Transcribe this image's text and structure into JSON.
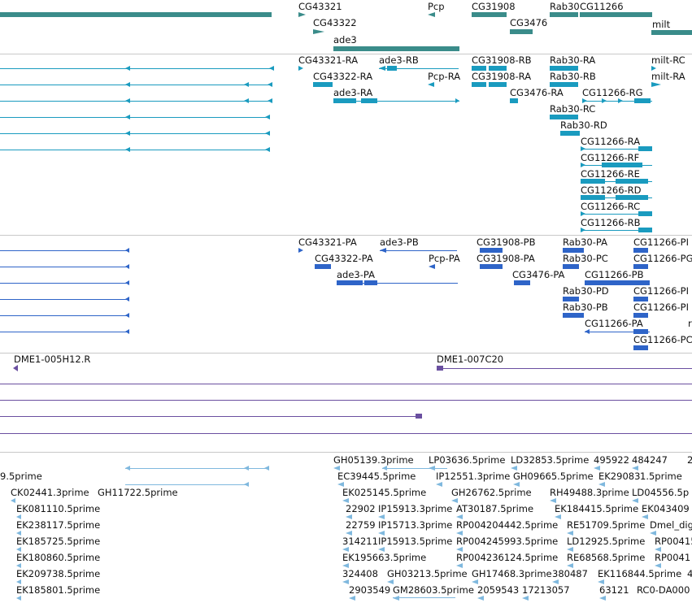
{
  "colors": {
    "gene": "#3a8c8a",
    "transcript": "#1a9bbf",
    "protein": "#2e64c8",
    "clone": "#6a4fa0",
    "est": "#7fb8de",
    "separator": "#c8c8c8"
  },
  "tracks": {
    "gene": {
      "labels": [
        "CG43321",
        "Pcp",
        "CG31908",
        "Rab30",
        "CG11266",
        "CG43322",
        "CG3476",
        "milt",
        "ade3"
      ]
    },
    "transcript": {
      "labels": [
        "CG43321-RA",
        "ade3-RB",
        "CG31908-RB",
        "Rab30-RA",
        "milt-RC",
        "CG43322-RA",
        "Pcp-RA",
        "CG31908-RA",
        "Rab30-RB",
        "milt-RA",
        "ade3-RA",
        "CG3476-RA",
        "CG11266-RG",
        "Rab30-RC",
        "Rab30-RD",
        "CG11266-RA",
        "CG11266-RF",
        "CG11266-RE",
        "CG11266-RD",
        "CG11266-RC",
        "CG11266-RB"
      ]
    },
    "protein": {
      "labels": [
        "CG43321-PA",
        "ade3-PB",
        "CG31908-PB",
        "Rab30-PA",
        "CG11266-PI",
        "CG43322-PA",
        "Pcp-PA",
        "CG31908-PA",
        "Rab30-PC",
        "CG11266-PG",
        "ade3-PA",
        "CG3476-PA",
        "CG11266-PB",
        "Rab30-PD",
        "CG11266-PI",
        "Rab30-PB",
        "CG11266-PI",
        "CG11266-PA",
        "r",
        "CG11266-PC"
      ]
    },
    "clone": {
      "labels": [
        "DME1-005H12.R",
        "DME1-007C20"
      ]
    },
    "est": {
      "labels": [
        "9.5prime",
        "CK02441.3prime",
        "GH11722.5prime",
        "EK081110.5prime",
        "EK238117.5prime",
        "EK185725.5prime",
        "EK180860.5prime",
        "EK209738.5prime",
        "EK185801.5prime",
        "GH05139.3prime",
        "LP03636.5prime",
        "LD32853.5prime",
        "495922",
        "484247",
        "2",
        "EC39445.5prime",
        "IP12551.3prime",
        "GH09665.5prime",
        "EK29083",
        "1.5prime",
        "EK025145.5prime",
        "GH26762.5prime",
        "RH49488.3prime",
        "LD04556.5p",
        "22902",
        "IP15913.3prime",
        "AT30187.5prime",
        "EK184415.5prime",
        "EK043409",
        "22759",
        "IP15713.3prime",
        "RP004204442.5prime",
        "RE51709.5prime",
        "Dmel_dig",
        "314211",
        "IP15913.5prime",
        "RP004245993.5prime",
        "LD12925.5prime",
        "RP00415",
        "EK195663.5prime",
        "RP004236124.5prime",
        "RE68568.5prime",
        "RP0041",
        "324408",
        "GH03213.5prime",
        "GH17468.3prime",
        "380487",
        "EK116844.5prime",
        "4",
        "2903549",
        "GM28603.5prime",
        "2059543",
        "17213057",
        "63121",
        "RC0-DA000"
      ]
    }
  }
}
